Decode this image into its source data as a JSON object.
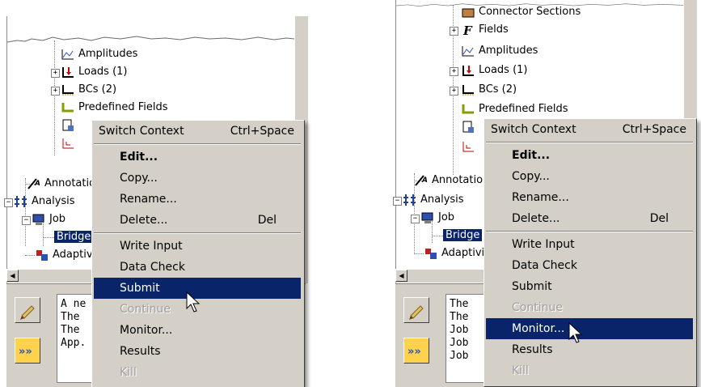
{
  "left": {
    "tree_items": [
      {
        "label": "Amplitudes"
      },
      {
        "label": "Loads (1)"
      },
      {
        "label": "BCs (2)"
      },
      {
        "label": "Predefined Fields"
      },
      {
        "label": "Annotations"
      },
      {
        "label": "Analysis"
      },
      {
        "label": "Job"
      },
      {
        "label": "Bridge"
      },
      {
        "label": "Adaptivity"
      }
    ],
    "messages": [
      "A ne",
      "The",
      "The",
      "App."
    ],
    "menu": {
      "switch_context": {
        "label": "Switch Context",
        "shortcut": "Ctrl+Space"
      },
      "edit": "Edit...",
      "copy": "Copy...",
      "rename": "Rename...",
      "delete": {
        "label": "Delete...",
        "shortcut": "Del"
      },
      "write_input": "Write Input",
      "data_check": "Data Check",
      "submit": "Submit",
      "continue": "Continue",
      "monitor": "Monitor...",
      "results": "Results",
      "kill": "Kill",
      "highlighted": "submit"
    }
  },
  "right": {
    "tree_items": [
      {
        "label": "Connector Sections"
      },
      {
        "label": "Fields"
      },
      {
        "label": "Amplitudes"
      },
      {
        "label": "Loads (1)"
      },
      {
        "label": "BCs (2)"
      },
      {
        "label": "Predefined Fields"
      },
      {
        "label": "Annotations"
      },
      {
        "label": "Analysis"
      },
      {
        "label": "Job"
      },
      {
        "label": "Bridge"
      },
      {
        "label": "Adaptivity"
      }
    ],
    "messages": [
      "The",
      "The",
      "Job",
      "Job",
      "Job"
    ],
    "menu": {
      "switch_context": {
        "label": "Switch Context",
        "shortcut": "Ctrl+Space"
      },
      "edit": "Edit...",
      "copy": "Copy...",
      "rename": "Rename...",
      "delete": {
        "label": "Delete...",
        "shortcut": "Del"
      },
      "write_input": "Write Input",
      "data_check": "Data Check",
      "submit": "Submit",
      "continue": "Continue",
      "monitor": "Monitor...",
      "results": "Results",
      "kill": "Kill",
      "highlighted": "monitor"
    }
  },
  "colors": {
    "menu_bg": "#d4d0c8",
    "highlight": "#0a246a",
    "disabled_text": "#a0a0a0",
    "side_button": "#ffd24d"
  },
  "icons": [
    "amplitude-icon",
    "load-icon",
    "bc-icon",
    "field-icon",
    "annotation-icon",
    "analysis-icon",
    "job-icon",
    "adaptivity-icon",
    "fields-f-icon",
    "connector-icon",
    "pencil-icon",
    "expand-arrows-icon",
    "arrow-cursor-icon"
  ]
}
